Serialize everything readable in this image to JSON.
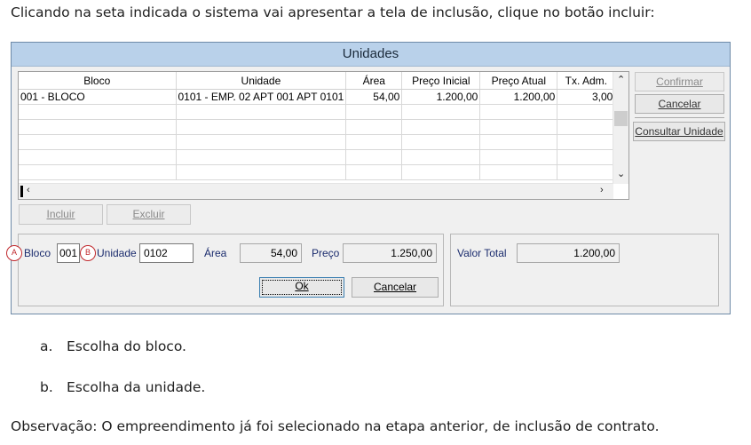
{
  "intro_text": "Clicando na seta indicada o sistema vai apresentar a tela de inclusão, clique no botão incluir:",
  "dialog": {
    "title": "Unidades",
    "grid": {
      "columns": [
        "Bloco",
        "Unidade",
        "Área",
        "Preço Inicial",
        "Preço Atual",
        "Tx. Adm."
      ],
      "rows": [
        [
          "001 - BLOCO",
          "0101 - EMP. 02 APT 001 APT 0101",
          "54,00",
          "1.200,00",
          "1.200,00",
          "3,00"
        ]
      ]
    },
    "side_buttons": {
      "confirmar": "Confirmar",
      "cancelar": "Cancelar",
      "consultar_unidade": "Consultar Unidade"
    },
    "grid_buttons": {
      "incluir": "Incluir",
      "excluir": "Excluir"
    },
    "form": {
      "bloco_label": "Bloco",
      "bloco_value": "001",
      "unidade_label": "Unidade",
      "unidade_value": "0102",
      "area_label": "Área",
      "area_value": "54,00",
      "preco_label": "Preço",
      "preco_value": "1.250,00",
      "ok_label": "Ok",
      "cancelar_label": "Cancelar"
    },
    "total": {
      "label": "Valor Total",
      "value": "1.200,00"
    },
    "markers": [
      "A",
      "B"
    ]
  },
  "list": [
    {
      "marker": "a.",
      "text": "Escolha do bloco."
    },
    {
      "marker": "b.",
      "text": "Escolha da unidade."
    }
  ],
  "observation": "Observação: O empreendimento já foi selecionado na etapa anterior, de inclusão de contrato."
}
